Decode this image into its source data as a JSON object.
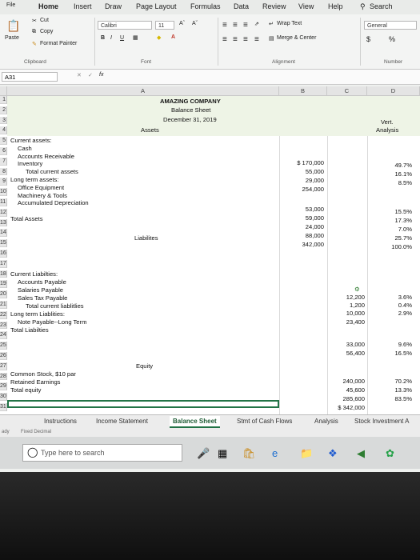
{
  "ribbon": {
    "tabs": [
      "File",
      "Home",
      "Insert",
      "Draw",
      "Page Layout",
      "Formulas",
      "Data",
      "Review",
      "View",
      "Help",
      "Search"
    ],
    "clipboard": {
      "cut": "Cut",
      "copy": "Copy",
      "paste": "Paste",
      "format_painter": "Format Painter",
      "label": "Clipboard"
    },
    "font": {
      "name": "Calibri",
      "size": "11",
      "bold": "B",
      "italic": "I",
      "underline": "U",
      "label": "Font"
    },
    "alignment": {
      "wrap": "Wrap Text",
      "merge": "Merge & Center",
      "label": "Alignment"
    },
    "number": {
      "format": "General",
      "label": "Number",
      "currency": "$",
      "percent": "%"
    }
  },
  "formula_bar": {
    "name_box": "A31",
    "fx": "fx",
    "value": ""
  },
  "columns": [
    "A",
    "B",
    "C",
    "D"
  ],
  "rows": [
    "1",
    "2",
    "3",
    "4",
    "5",
    "6",
    "7",
    "8",
    "9",
    "10",
    "11",
    "12",
    "13",
    "14",
    "15",
    "16",
    "17",
    "18",
    "19",
    "20",
    "21",
    "22",
    "23",
    "24",
    "25",
    "26",
    "27",
    "28",
    "29",
    "30",
    "31"
  ],
  "sheet": {
    "title": "AMAZING COMPANY",
    "subtitle": "Balance Sheet",
    "date": "December 31, 2019",
    "vert": "Vert.",
    "analysis": "Analysis",
    "assets_header": "Assets",
    "liabilities_header": "Liabilites",
    "equity_header": "Equity",
    "labels": {
      "r5": "Current assets:",
      "r6": "Cash",
      "r7": "Accounts Receivable",
      "r8": "Inventory",
      "r9": "Total current assets",
      "r10": "Long term assets:",
      "r11": "Office Equipment",
      "r12": "Machinery & Tools",
      "r13": "Accumulated Depreciation",
      "r15": "Total Assets",
      "r18": "Current Liabilties:",
      "r19": "Accounts Payable",
      "r20": "Salaries Payable",
      "r21": "Sales Tax Payable",
      "r22": "Total current liablitlies",
      "r23": "Long term Liablities:",
      "r24": "Note Payable--Long Term",
      "r25": "Total Liabilties",
      "r28": "Common Stock, $10 par",
      "r29": "Retained Earnings",
      "r30": "Total equity"
    },
    "assets_values": [
      "$ 170,000",
      "55,000",
      "29,000",
      "254,000",
      "53,000",
      "59,000",
      "24,000",
      "88,000",
      "342,000"
    ],
    "assets_pct": [
      "49.7%",
      "16.1%",
      "8.5%",
      "15.5%",
      "17.3%",
      "7.0%",
      "25.7%",
      "100.0%"
    ],
    "liab_values": [
      "12,200",
      "1,200",
      "10,000",
      "23,400",
      "33,000",
      "56,400"
    ],
    "liab_pct": [
      "3.6%",
      "0.4%",
      "2.9%",
      "9.6%",
      "16.5%"
    ],
    "equity_values": [
      "240,000",
      "45,600",
      "285,600",
      "$ 342,000"
    ],
    "equity_pct": [
      "70.2%",
      "13.3%",
      "83.5%"
    ]
  },
  "sheet_tabs": [
    "Instructions",
    "Income Statement",
    "Balance Sheet",
    "Stmt of Cash Flows",
    "Analysis",
    "Stock Investment A"
  ],
  "status": {
    "left": "ady",
    "mode": "Fixed Decimal"
  },
  "taskbar": {
    "search_placeholder": "Type here to search"
  }
}
